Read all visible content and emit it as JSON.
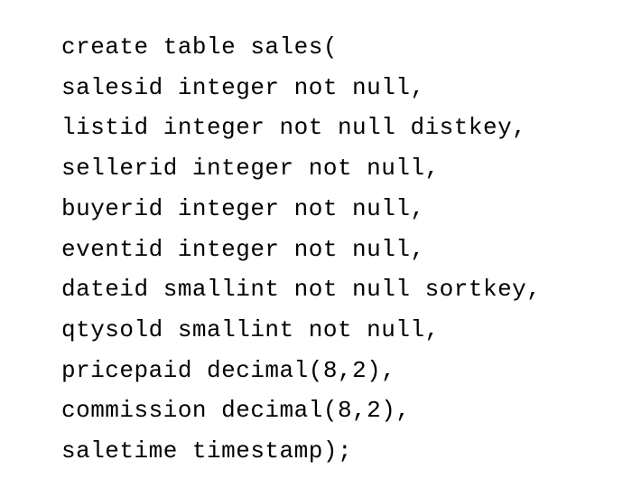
{
  "code": {
    "lines": [
      "create table sales(",
      "salesid integer not null,",
      "listid integer not null distkey,",
      "sellerid integer not null,",
      "buyerid integer not null,",
      "eventid integer not null,",
      "dateid smallint not null sortkey,",
      "qtysold smallint not null,",
      "pricepaid decimal(8,2),",
      "commission decimal(8,2),",
      "saletime timestamp);"
    ]
  }
}
